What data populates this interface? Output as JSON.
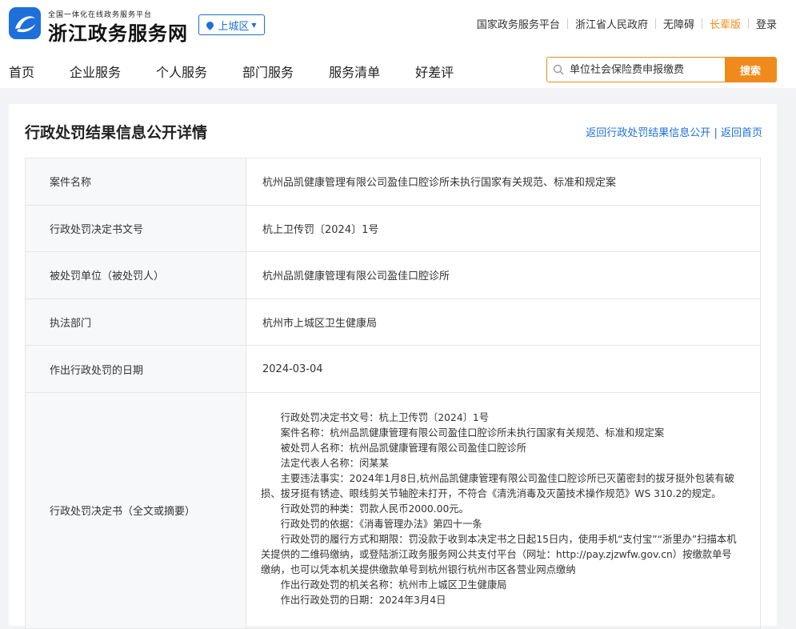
{
  "header": {
    "logo_subtitle": "全国一体化在线政务服务平台",
    "logo_title": "浙江政务服务网",
    "region": "上城区",
    "top_links": [
      "国家政务服务平台",
      "浙江省人民政府",
      "无障碍",
      "长辈版",
      "登录"
    ],
    "nav": [
      "首页",
      "企业服务",
      "个人服务",
      "部门服务",
      "服务清单",
      "好差评"
    ],
    "search_placeholder": "单位社会保险费申报缴费",
    "search_button": "搜索",
    "accent_color": "#f08a1c",
    "brand_color": "#1e6fd9"
  },
  "page": {
    "title": "行政处罚结果信息公开详情",
    "link_back_list": "返回行政处罚结果信息公开",
    "link_separator": "|",
    "link_home": "返回首页"
  },
  "detail": {
    "rows": [
      {
        "label": "案件名称",
        "value": "杭州品凯健康管理有限公司盈佳口腔诊所未执行国家有关规范、标准和规定案"
      },
      {
        "label": "行政处罚决定书文号",
        "value": "杭上卫传罚〔2024〕1号"
      },
      {
        "label": "被处罚单位（被处罚人）",
        "value": "杭州品凯健康管理有限公司盈佳口腔诊所"
      },
      {
        "label": "执法部门",
        "value": "杭州市上城区卫生健康局"
      },
      {
        "label": "作出行政处罚的日期",
        "value": "2024-03-04"
      }
    ],
    "decision_label": "行政处罚决定书（全文或摘要）",
    "decision_paragraphs": [
      "行政处罚决定书文号：杭上卫传罚〔2024〕1号",
      "案件名称：杭州品凯健康管理有限公司盈佳口腔诊所未执行国家有关规范、标准和规定案",
      "被处罚人名称：杭州品凯健康管理有限公司盈佳口腔诊所",
      "法定代表人名称：闵某某",
      "主要违法事实：2024年1月8日,杭州品凯健康管理有限公司盈佳口腔诊所已灭菌密封的拔牙挺外包装有破损、拔牙挺有锈迹、眼线剪关节轴腔未打开，不符合《清洗消毒及灭菌技术操作规范》WS 310.2的规定。",
      "行政处罚的种类：罚款人民币2000.00元。",
      "行政处罚的依据：《消毒管理办法》第四十一条",
      "行政处罚的履行方式和期限：罚没款于收到本决定书之日起15日内，使用手机“支付宝”“浙里办”扫描本机关提供的二维码缴纳，或登陆浙江政务服务网公共支付平台（网址：http://pay.zjzwfw.gov.cn）按缴款单号缴纳，也可以凭本机关提供缴款单号到杭州银行杭州市区各营业网点缴纳",
      "作出行政处罚的机关名称：杭州市上城区卫生健康局",
      "作出行政处罚的日期：2024年3月4日"
    ]
  }
}
